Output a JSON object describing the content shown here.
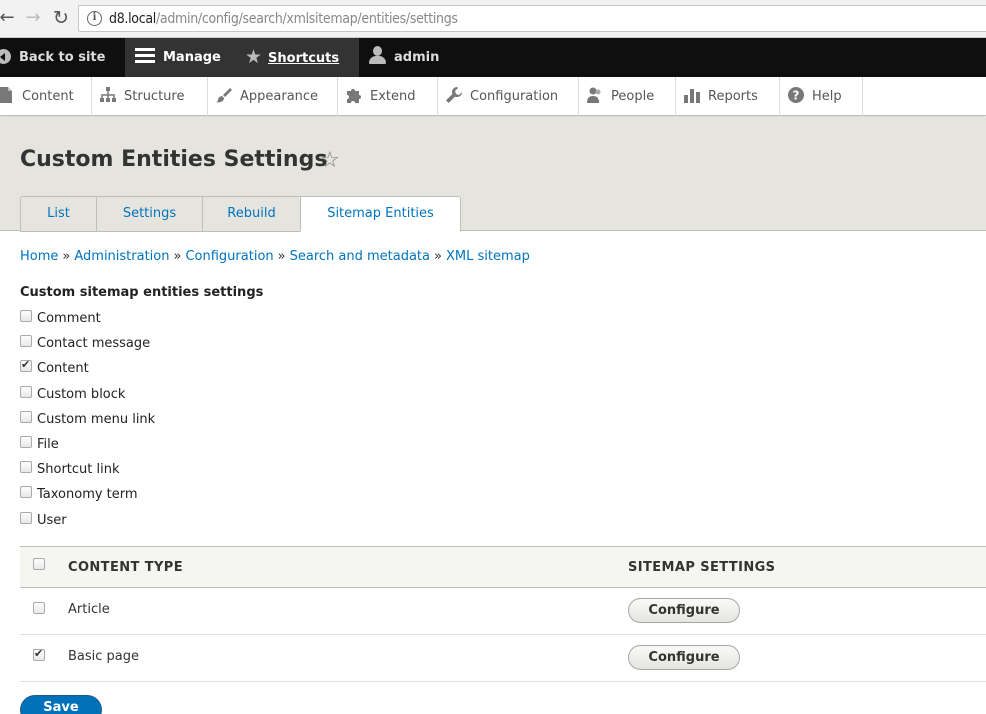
{
  "browser": {
    "url_host": "d8.local",
    "url_path": "/admin/config/search/xmlsitemap/entities/settings"
  },
  "toolbar": {
    "back_label": "Back to site",
    "manage_label": "Manage",
    "shortcuts_label": "Shortcuts",
    "user_label": "admin"
  },
  "tray": {
    "items": [
      {
        "label": "Content",
        "icon": "file-icon"
      },
      {
        "label": "Structure",
        "icon": "structure-icon"
      },
      {
        "label": "Appearance",
        "icon": "paintbrush-icon"
      },
      {
        "label": "Extend",
        "icon": "puzzle-icon"
      },
      {
        "label": "Configuration",
        "icon": "wrench-icon"
      },
      {
        "label": "People",
        "icon": "people-icon"
      },
      {
        "label": "Reports",
        "icon": "bar-chart-icon"
      },
      {
        "label": "Help",
        "icon": "help-icon"
      }
    ]
  },
  "page": {
    "title": "Custom Entities Settings",
    "tabs": [
      {
        "label": "List"
      },
      {
        "label": "Settings"
      },
      {
        "label": "Rebuild"
      },
      {
        "label": "Sitemap Entities",
        "active": true
      }
    ]
  },
  "breadcrumb": [
    "Home",
    "Administration",
    "Configuration",
    "Search and metadata",
    "XML sitemap"
  ],
  "breadcrumb_separator": "»",
  "entities": {
    "title": "Custom sitemap entities settings",
    "options": [
      {
        "label": "Comment",
        "checked": false
      },
      {
        "label": "Contact message",
        "checked": false
      },
      {
        "label": "Content",
        "checked": true
      },
      {
        "label": "Custom block",
        "checked": false
      },
      {
        "label": "Custom menu link",
        "checked": false
      },
      {
        "label": "File",
        "checked": false
      },
      {
        "label": "Shortcut link",
        "checked": false
      },
      {
        "label": "Taxonomy term",
        "checked": false
      },
      {
        "label": "User",
        "checked": false
      }
    ]
  },
  "table": {
    "headers": {
      "content_type": "CONTENT TYPE",
      "sitemap_settings": "SITEMAP SETTINGS"
    },
    "rows": [
      {
        "name": "Article",
        "checked": false,
        "button": "Configure"
      },
      {
        "name": "Basic page",
        "checked": true,
        "button": "Configure"
      }
    ]
  },
  "actions": {
    "save_label": "Save"
  },
  "colors": {
    "link": "#0074bd",
    "toolbar_bg": "#0f0f0f",
    "header_bg": "#e6e4df",
    "primary_button": "#0071b8"
  }
}
